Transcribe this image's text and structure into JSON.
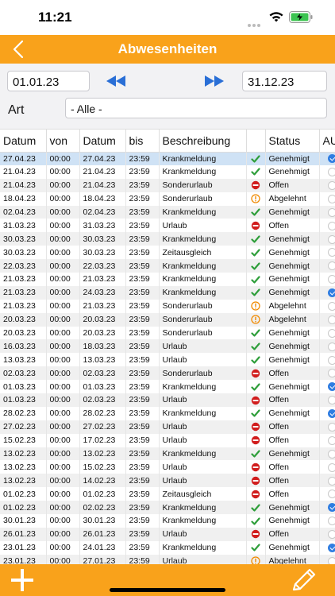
{
  "status_bar": {
    "time": "11:21"
  },
  "nav": {
    "title": "Abwesenheiten"
  },
  "filters": {
    "date_from": "01.01.23",
    "date_to": "31.12.23",
    "art_label": "Art",
    "art_value": "- Alle -"
  },
  "table": {
    "headers": [
      "Datum",
      "von",
      "Datum",
      "bis",
      "Beschreibung",
      "",
      "Status",
      "AU"
    ],
    "rows": [
      {
        "d1": "27.04.23",
        "von": "00:00",
        "d2": "27.04.23",
        "bis": "23:59",
        "desc": "Krankmeldung",
        "icon": "check-icon",
        "status": "Genehmigt",
        "au": true
      },
      {
        "d1": "21.04.23",
        "von": "00:00",
        "d2": "21.04.23",
        "bis": "23:59",
        "desc": "Krankmeldung",
        "icon": "check-icon",
        "status": "Genehmigt",
        "au": false
      },
      {
        "d1": "21.04.23",
        "von": "00:00",
        "d2": "21.04.23",
        "bis": "23:59",
        "desc": "Sonderurlaub",
        "icon": "no-entry-icon",
        "status": "Offen",
        "au": false
      },
      {
        "d1": "18.04.23",
        "von": "00:00",
        "d2": "18.04.23",
        "bis": "23:59",
        "desc": "Sonderurlaub",
        "icon": "warning-icon",
        "status": "Abgelehnt",
        "au": false
      },
      {
        "d1": "02.04.23",
        "von": "00:00",
        "d2": "02.04.23",
        "bis": "23:59",
        "desc": "Krankmeldung",
        "icon": "check-icon",
        "status": "Genehmigt",
        "au": false
      },
      {
        "d1": "31.03.23",
        "von": "00:00",
        "d2": "31.03.23",
        "bis": "23:59",
        "desc": "Urlaub",
        "icon": "no-entry-icon",
        "status": "Offen",
        "au": false
      },
      {
        "d1": "30.03.23",
        "von": "00:00",
        "d2": "30.03.23",
        "bis": "23:59",
        "desc": "Krankmeldung",
        "icon": "check-icon",
        "status": "Genehmigt",
        "au": false
      },
      {
        "d1": "30.03.23",
        "von": "00:00",
        "d2": "30.03.23",
        "bis": "23:59",
        "desc": "Zeitausgleich",
        "icon": "check-icon",
        "status": "Genehmigt",
        "au": false
      },
      {
        "d1": "22.03.23",
        "von": "00:00",
        "d2": "22.03.23",
        "bis": "23:59",
        "desc": "Krankmeldung",
        "icon": "check-icon",
        "status": "Genehmigt",
        "au": false
      },
      {
        "d1": "21.03.23",
        "von": "00:00",
        "d2": "21.03.23",
        "bis": "23:59",
        "desc": "Krankmeldung",
        "icon": "check-icon",
        "status": "Genehmigt",
        "au": false
      },
      {
        "d1": "21.03.23",
        "von": "00:00",
        "d2": "24.03.23",
        "bis": "23:59",
        "desc": "Krankmeldung",
        "icon": "check-icon",
        "status": "Genehmigt",
        "au": true
      },
      {
        "d1": "21.03.23",
        "von": "00:00",
        "d2": "21.03.23",
        "bis": "23:59",
        "desc": "Sonderurlaub",
        "icon": "warning-icon",
        "status": "Abgelehnt",
        "au": false
      },
      {
        "d1": "20.03.23",
        "von": "00:00",
        "d2": "20.03.23",
        "bis": "23:59",
        "desc": "Sonderurlaub",
        "icon": "warning-icon",
        "status": "Abgelehnt",
        "au": false
      },
      {
        "d1": "20.03.23",
        "von": "00:00",
        "d2": "20.03.23",
        "bis": "23:59",
        "desc": "Sonderurlaub",
        "icon": "check-icon",
        "status": "Genehmigt",
        "au": false
      },
      {
        "d1": "16.03.23",
        "von": "00:00",
        "d2": "18.03.23",
        "bis": "23:59",
        "desc": "Urlaub",
        "icon": "check-icon",
        "status": "Genehmigt",
        "au": false
      },
      {
        "d1": "13.03.23",
        "von": "00:00",
        "d2": "13.03.23",
        "bis": "23:59",
        "desc": "Urlaub",
        "icon": "check-icon",
        "status": "Genehmigt",
        "au": false
      },
      {
        "d1": "02.03.23",
        "von": "00:00",
        "d2": "02.03.23",
        "bis": "23:59",
        "desc": "Sonderurlaub",
        "icon": "no-entry-icon",
        "status": "Offen",
        "au": false
      },
      {
        "d1": "01.03.23",
        "von": "00:00",
        "d2": "01.03.23",
        "bis": "23:59",
        "desc": "Krankmeldung",
        "icon": "check-icon",
        "status": "Genehmigt",
        "au": true
      },
      {
        "d1": "01.03.23",
        "von": "00:00",
        "d2": "02.03.23",
        "bis": "23:59",
        "desc": "Urlaub",
        "icon": "no-entry-icon",
        "status": "Offen",
        "au": false
      },
      {
        "d1": "28.02.23",
        "von": "00:00",
        "d2": "28.02.23",
        "bis": "23:59",
        "desc": "Krankmeldung",
        "icon": "check-icon",
        "status": "Genehmigt",
        "au": true
      },
      {
        "d1": "27.02.23",
        "von": "00:00",
        "d2": "27.02.23",
        "bis": "23:59",
        "desc": "Urlaub",
        "icon": "no-entry-icon",
        "status": "Offen",
        "au": false
      },
      {
        "d1": "15.02.23",
        "von": "00:00",
        "d2": "17.02.23",
        "bis": "23:59",
        "desc": "Urlaub",
        "icon": "no-entry-icon",
        "status": "Offen",
        "au": false
      },
      {
        "d1": "13.02.23",
        "von": "00:00",
        "d2": "13.02.23",
        "bis": "23:59",
        "desc": "Krankmeldung",
        "icon": "check-icon",
        "status": "Genehmigt",
        "au": false
      },
      {
        "d1": "13.02.23",
        "von": "00:00",
        "d2": "15.02.23",
        "bis": "23:59",
        "desc": "Urlaub",
        "icon": "no-entry-icon",
        "status": "Offen",
        "au": false
      },
      {
        "d1": "13.02.23",
        "von": "00:00",
        "d2": "14.02.23",
        "bis": "23:59",
        "desc": "Urlaub",
        "icon": "no-entry-icon",
        "status": "Offen",
        "au": false
      },
      {
        "d1": "01.02.23",
        "von": "00:00",
        "d2": "01.02.23",
        "bis": "23:59",
        "desc": "Zeitausgleich",
        "icon": "no-entry-icon",
        "status": "Offen",
        "au": false
      },
      {
        "d1": "01.02.23",
        "von": "00:00",
        "d2": "02.02.23",
        "bis": "23:59",
        "desc": "Krankmeldung",
        "icon": "check-icon",
        "status": "Genehmigt",
        "au": true
      },
      {
        "d1": "30.01.23",
        "von": "00:00",
        "d2": "30.01.23",
        "bis": "23:59",
        "desc": "Krankmeldung",
        "icon": "check-icon",
        "status": "Genehmigt",
        "au": false
      },
      {
        "d1": "26.01.23",
        "von": "00:00",
        "d2": "26.01.23",
        "bis": "23:59",
        "desc": "Urlaub",
        "icon": "no-entry-icon",
        "status": "Offen",
        "au": false
      },
      {
        "d1": "23.01.23",
        "von": "00:00",
        "d2": "24.01.23",
        "bis": "23:59",
        "desc": "Krankmeldung",
        "icon": "check-icon",
        "status": "Genehmigt",
        "au": true
      },
      {
        "d1": "23.01.23",
        "von": "00:00",
        "d2": "27.01.23",
        "bis": "23:59",
        "desc": "Urlaub",
        "icon": "warning-icon",
        "status": "Abgelehnt",
        "au": false
      }
    ]
  },
  "colors": {
    "accent": "#f9a21b",
    "approved": "#2e9e3a",
    "open": "#d11d1d",
    "rejected": "#f08a00",
    "au_checked": "#2f7de1"
  }
}
